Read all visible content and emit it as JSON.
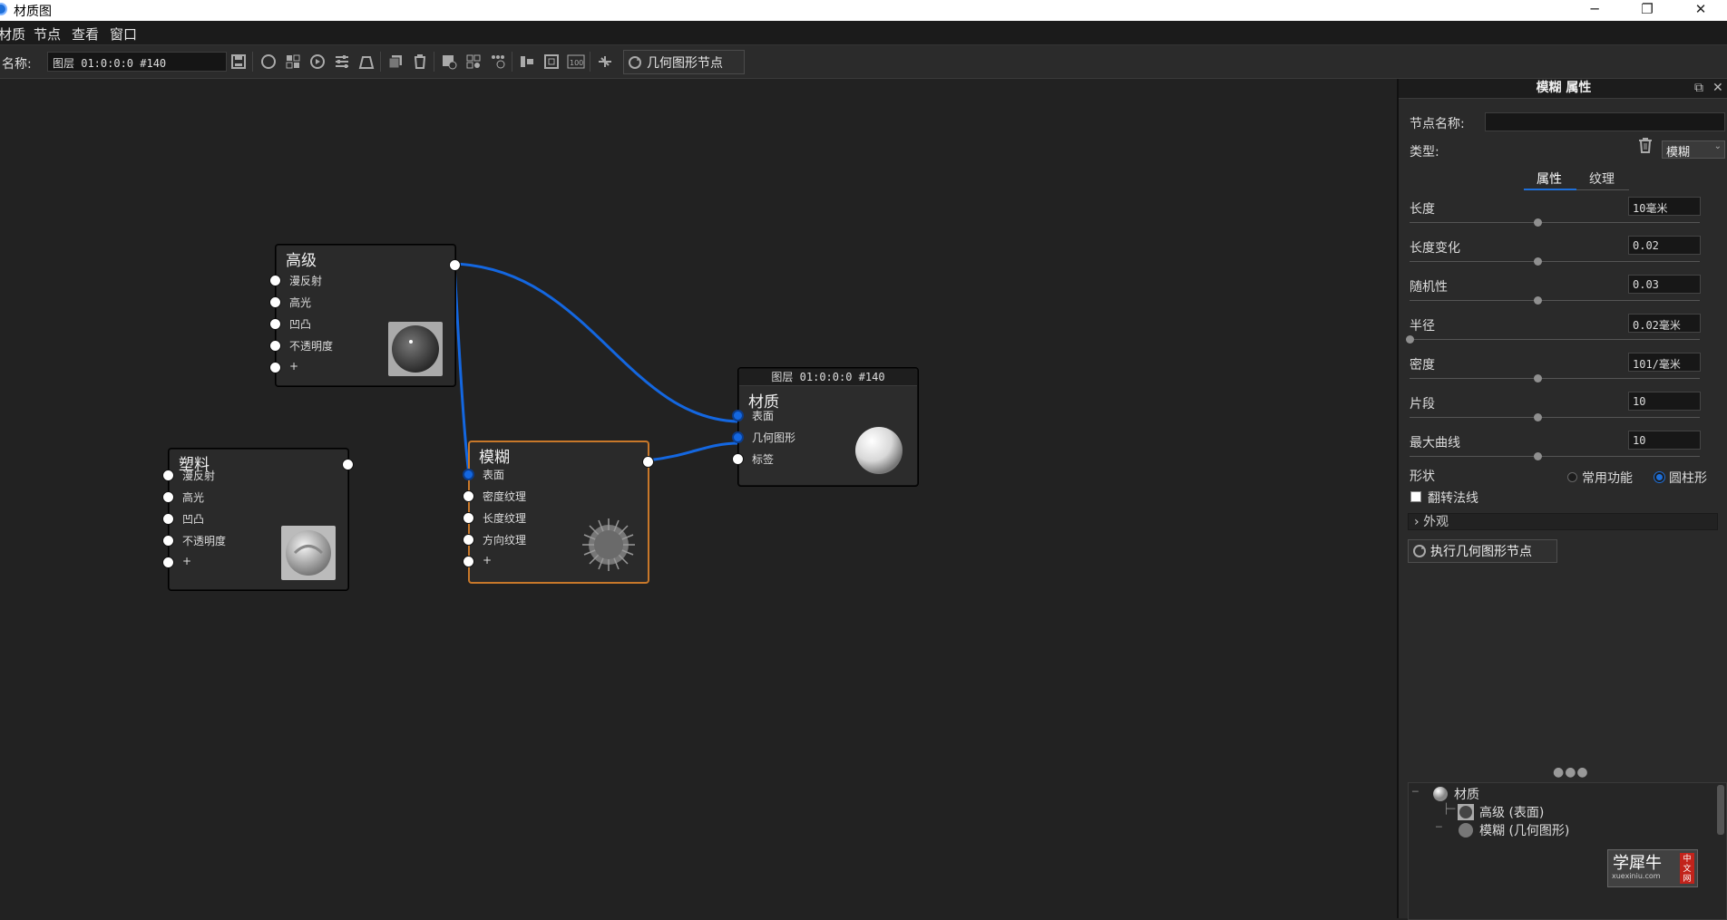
{
  "window": {
    "title": "材质图",
    "minimize": "─",
    "maximize": "❐",
    "close": "✕"
  },
  "menu": {
    "items": [
      "材质",
      "节点",
      "查看",
      "窗口"
    ]
  },
  "toolbar": {
    "name_label": "名称:",
    "name_value": "图层 01:0:0:0 #140",
    "geo_button": "几何图形节点"
  },
  "nodes": {
    "advanced": {
      "title": "高级",
      "ports": [
        "漫反射",
        "高光",
        "凹凸",
        "不透明度",
        "+"
      ]
    },
    "plastic": {
      "title": "塑料",
      "ports": [
        "漫反射",
        "高光",
        "凹凸",
        "不透明度",
        "+"
      ]
    },
    "blur": {
      "title": "模糊",
      "ports": [
        "表面",
        "密度纹理",
        "长度纹理",
        "方向纹理",
        "+"
      ]
    },
    "material": {
      "header": "图层 01:0:0:0 #140",
      "title": "材质",
      "ports": [
        "表面",
        "几何图形",
        "标签"
      ]
    }
  },
  "panel": {
    "title": "模糊 属性",
    "node_name_label": "节点名称:",
    "node_name_value": "",
    "type_label": "类型:",
    "type_value": "模糊",
    "tabs": [
      "属性",
      "纹理"
    ],
    "active_tab": "属性",
    "properties": [
      {
        "label": "长度",
        "value": "10毫米",
        "slider": 0.44
      },
      {
        "label": "长度变化",
        "value": "0.02",
        "slider": 0.44
      },
      {
        "label": "随机性",
        "value": "0.03",
        "slider": 0.44
      },
      {
        "label": "半径",
        "value": "0.02毫米",
        "slider": 0.0
      },
      {
        "label": "密度",
        "value": "101/毫米",
        "slider": 0.44
      },
      {
        "label": "片段",
        "value": "10",
        "slider": 0.44
      },
      {
        "label": "最大曲线",
        "value": "10",
        "slider": 0.44
      }
    ],
    "shape_label": "形状",
    "shape_options": [
      "常用功能",
      "圆柱形"
    ],
    "shape_selected": "圆柱形",
    "flip_normals_label": "翻转法线",
    "flip_normals_checked": false,
    "appearance_label": "外观",
    "execute_button": "执行几何图形节点",
    "tree": [
      {
        "label": "材质"
      },
      {
        "label": "高级 (表面)"
      },
      {
        "label": "模糊 (几何图形)"
      }
    ]
  },
  "watermark": {
    "text": "学犀牛",
    "sub": "xuexiniu.com",
    "badge": "中文网"
  },
  "colors": {
    "accent": "#1e6fd9",
    "wire": "#1467e0",
    "selected_border": "#c8782a",
    "canvas": "#222222"
  }
}
